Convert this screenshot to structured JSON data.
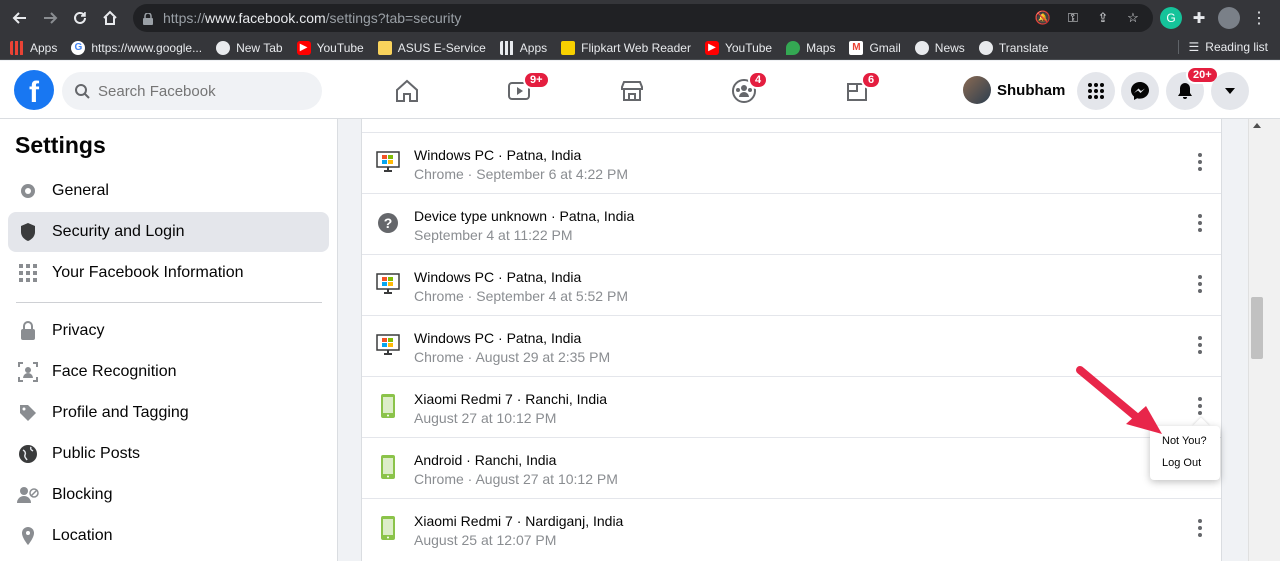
{
  "browser": {
    "url_prefix": "https://",
    "url_host": "www.facebook.com",
    "url_path": "/settings?tab=security",
    "bookmarks": [
      {
        "label": "Apps",
        "icon": "apps-grid-icon"
      },
      {
        "label": "https://www.google...",
        "icon": "google-icon"
      },
      {
        "label": "New Tab",
        "icon": "globe-icon"
      },
      {
        "label": "YouTube",
        "icon": "youtube-icon"
      },
      {
        "label": "ASUS E-Service",
        "icon": "bookmark-folder-icon"
      },
      {
        "label": "Apps",
        "icon": "apps-grid-icon"
      },
      {
        "label": "Flipkart Web Reader",
        "icon": "flipkart-icon"
      },
      {
        "label": "YouTube",
        "icon": "youtube-icon"
      },
      {
        "label": "Maps",
        "icon": "maps-icon"
      },
      {
        "label": "Gmail",
        "icon": "gmail-icon"
      },
      {
        "label": "News",
        "icon": "globe-icon"
      },
      {
        "label": "Translate",
        "icon": "globe-icon"
      }
    ],
    "reading_list": "Reading list",
    "extension_letter": "G"
  },
  "fb": {
    "search_placeholder": "Search Facebook",
    "video_badge": "9+",
    "groups_badge": "4",
    "gaming_badge": "6",
    "user_name": "Shubham",
    "notif_badge": "20+"
  },
  "sidebar": {
    "title": "Settings",
    "items": [
      {
        "label": "General"
      },
      {
        "label": "Security and Login"
      },
      {
        "label": "Your Facebook Information"
      },
      {
        "label": "Privacy"
      },
      {
        "label": "Face Recognition"
      },
      {
        "label": "Profile and Tagging"
      },
      {
        "label": "Public Posts"
      },
      {
        "label": "Blocking"
      },
      {
        "label": "Location"
      }
    ]
  },
  "sessions": [
    {
      "device": "Windows PC",
      "place": "Patna, India",
      "detail": "Chrome · September 6 at 4:22 PM",
      "icon": "windows-pc-icon"
    },
    {
      "device": "Device type unknown",
      "place": "Patna, India",
      "detail": "September 4 at 11:22 PM",
      "icon": "unknown-device-icon"
    },
    {
      "device": "Windows PC",
      "place": "Patna, India",
      "detail": "Chrome · September 4 at 5:52 PM",
      "icon": "windows-pc-icon"
    },
    {
      "device": "Windows PC",
      "place": "Patna, India",
      "detail": "Chrome · August 29 at 2:35 PM",
      "icon": "windows-pc-icon"
    },
    {
      "device": "Xiaomi Redmi 7",
      "place": "Ranchi, India",
      "detail": "August 27 at 10:12 PM",
      "icon": "android-phone-icon"
    },
    {
      "device": "Android",
      "place": "Ranchi, India",
      "detail": "Chrome · August 27 at 10:12 PM",
      "icon": "android-phone-icon"
    },
    {
      "device": "Xiaomi Redmi 7",
      "place": "Nardiganj, India",
      "detail": "August 25 at 12:07 PM",
      "icon": "android-phone-icon"
    }
  ],
  "session_menu": {
    "not_you": "Not You?",
    "log_out": "Log Out"
  },
  "colors": {
    "brand": "#1877f2",
    "badge": "#e41e3f",
    "arrow": "#e8264a"
  }
}
